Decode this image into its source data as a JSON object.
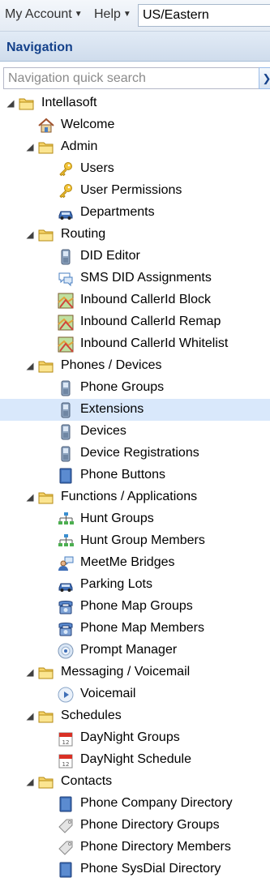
{
  "topbar": {
    "account_menu": "My Account",
    "help_menu": "Help",
    "timezone_value": "US/Eastern"
  },
  "nav": {
    "title": "Navigation",
    "search_placeholder": "Navigation quick search"
  },
  "tree": [
    {
      "label": "Intellasoft",
      "icon": "folder-icon",
      "level": 0,
      "expanded": true
    },
    {
      "label": "Welcome",
      "icon": "home-icon",
      "level": 1
    },
    {
      "label": "Admin",
      "icon": "folder-icon",
      "level": 1,
      "expanded": true
    },
    {
      "label": "Users",
      "icon": "key-icon",
      "level": 2
    },
    {
      "label": "User Permissions",
      "icon": "key-icon",
      "level": 2
    },
    {
      "label": "Departments",
      "icon": "car-icon",
      "level": 2
    },
    {
      "label": "Routing",
      "icon": "folder-icon",
      "level": 1,
      "expanded": true
    },
    {
      "label": "DID Editor",
      "icon": "phone-icon",
      "level": 2
    },
    {
      "label": "SMS DID Assignments",
      "icon": "chat-icon",
      "level": 2
    },
    {
      "label": "Inbound CallerId Block",
      "icon": "map-icon",
      "level": 2
    },
    {
      "label": "Inbound CallerId Remap",
      "icon": "map-icon",
      "level": 2
    },
    {
      "label": "Inbound CallerId Whitelist",
      "icon": "map-icon",
      "level": 2
    },
    {
      "label": "Phones / Devices",
      "icon": "folder-icon",
      "level": 1,
      "expanded": true
    },
    {
      "label": "Phone Groups",
      "icon": "phone-icon",
      "level": 2
    },
    {
      "label": "Extensions",
      "icon": "phone-icon",
      "level": 2,
      "selected": true
    },
    {
      "label": "Devices",
      "icon": "phone-icon",
      "level": 2
    },
    {
      "label": "Device Registrations",
      "icon": "phone-icon",
      "level": 2
    },
    {
      "label": "Phone Buttons",
      "icon": "book-icon",
      "level": 2
    },
    {
      "label": "Functions / Applications",
      "icon": "folder-icon",
      "level": 1,
      "expanded": true
    },
    {
      "label": "Hunt Groups",
      "icon": "hierarchy-icon",
      "level": 2
    },
    {
      "label": "Hunt Group Members",
      "icon": "hierarchy-icon",
      "level": 2
    },
    {
      "label": "MeetMe Bridges",
      "icon": "user-chat-icon",
      "level": 2
    },
    {
      "label": "Parking Lots",
      "icon": "car-icon",
      "level": 2
    },
    {
      "label": "Phone Map Groups",
      "icon": "desk-phone-icon",
      "level": 2
    },
    {
      "label": "Phone Map Members",
      "icon": "desk-phone-icon",
      "level": 2
    },
    {
      "label": "Prompt Manager",
      "icon": "disc-icon",
      "level": 2
    },
    {
      "label": "Messaging / Voicemail",
      "icon": "folder-icon",
      "level": 1,
      "expanded": true
    },
    {
      "label": "Voicemail",
      "icon": "play-icon",
      "level": 2
    },
    {
      "label": "Schedules",
      "icon": "folder-icon",
      "level": 1,
      "expanded": true
    },
    {
      "label": "DayNight Groups",
      "icon": "calendar-icon",
      "level": 2
    },
    {
      "label": "DayNight Schedule",
      "icon": "calendar-icon",
      "level": 2
    },
    {
      "label": "Contacts",
      "icon": "folder-icon",
      "level": 1,
      "expanded": true
    },
    {
      "label": "Phone Company Directory",
      "icon": "book-icon",
      "level": 2
    },
    {
      "label": "Phone Directory Groups",
      "icon": "tag-icon",
      "level": 2
    },
    {
      "label": "Phone Directory Members",
      "icon": "tag-icon",
      "level": 2
    },
    {
      "label": "Phone SysDial Directory",
      "icon": "book-icon",
      "level": 2
    }
  ]
}
